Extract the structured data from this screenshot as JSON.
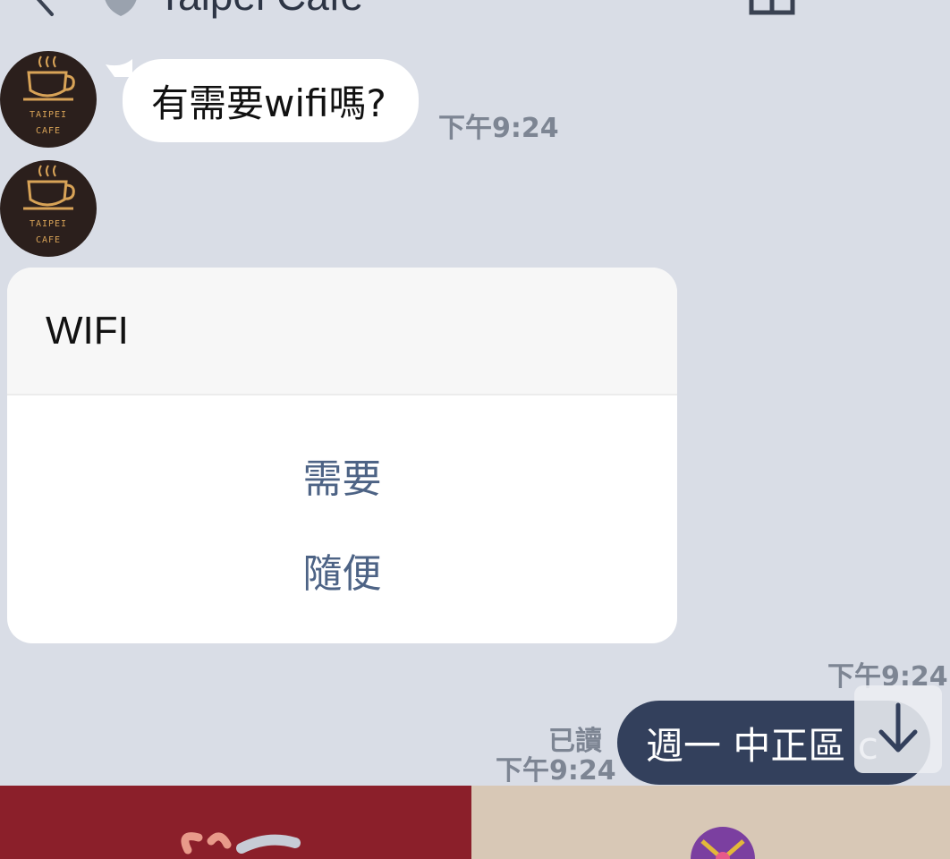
{
  "header": {
    "title": "Taipei Cafe",
    "back_icon": "chevron-left-icon",
    "shield_icon": "shield-icon",
    "home_icon": "home-icon",
    "menu_icon": "chevron-down-icon"
  },
  "avatar": {
    "line1": "TAIPEI",
    "line2": "CAFE",
    "icon": "coffee-cup-icon"
  },
  "messages": [
    {
      "text": "有需要wifi嗎?",
      "time": "下午9:24"
    },
    {
      "card_title": "WIFI",
      "options": [
        "需要",
        "隨便"
      ],
      "time": "下午9:24"
    }
  ],
  "sent": {
    "text": "週一 中正區 c",
    "read_label": "已讀",
    "time": "下午9:24"
  },
  "scroll_button_icon": "arrow-down-icon",
  "colors": {
    "background": "#d9dde6",
    "sent_bubble": "#33405c",
    "option_text": "#4d6385",
    "time_text": "#7d8593"
  }
}
